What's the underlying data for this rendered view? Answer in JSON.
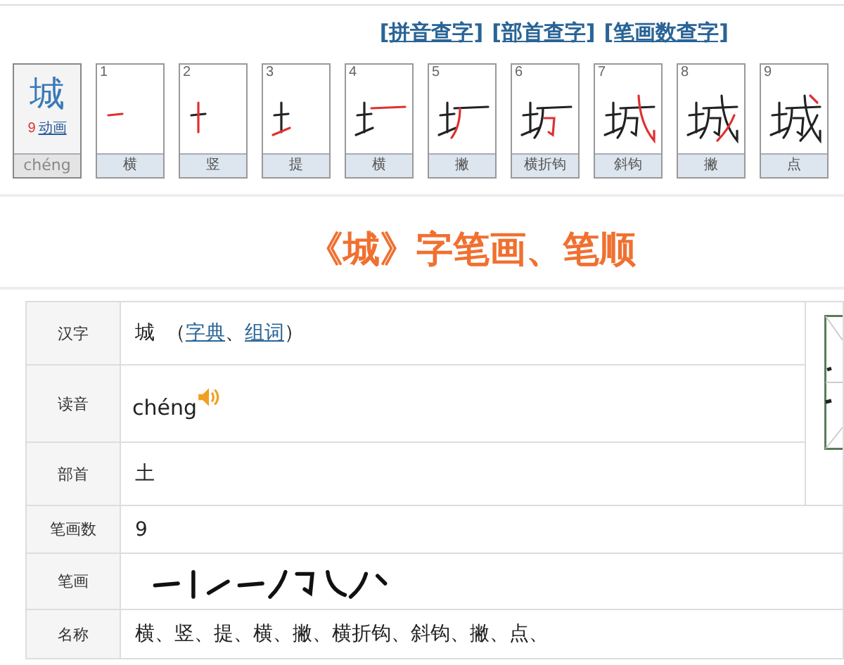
{
  "nav_links": [
    "[拼音查字]",
    "[部首查字]",
    "[笔画数查字]"
  ],
  "character_card": {
    "character": "城",
    "stroke_count": "9",
    "animation_link": "动画",
    "pinyin": "chéng"
  },
  "stroke_cards": [
    {
      "number": "1",
      "name": "横"
    },
    {
      "number": "2",
      "name": "竖"
    },
    {
      "number": "3",
      "name": "提"
    },
    {
      "number": "4",
      "name": "横"
    },
    {
      "number": "5",
      "name": "撇"
    },
    {
      "number": "6",
      "name": "横折钩"
    },
    {
      "number": "7",
      "name": "斜钩"
    },
    {
      "number": "8",
      "name": "撇"
    },
    {
      "number": "9",
      "name": "点"
    }
  ],
  "title": "《城》字笔画、笔顺",
  "info_table": {
    "rows": [
      {
        "label": "汉字",
        "kind": "character",
        "value": "城",
        "open": "（",
        "links": [
          "字典",
          "组词"
        ],
        "separator": "、",
        "close": "）"
      },
      {
        "label": "读音",
        "kind": "pinyin",
        "value": "chéng"
      },
      {
        "label": "部首",
        "kind": "text",
        "value": "土"
      },
      {
        "label": "笔画数",
        "kind": "text",
        "value": "9"
      },
      {
        "label": "笔画",
        "kind": "strokes"
      },
      {
        "label": "名称",
        "kind": "text",
        "value": "横、竖、提、横、撇、横折钩、斜钩、撇、点、"
      }
    ]
  }
}
